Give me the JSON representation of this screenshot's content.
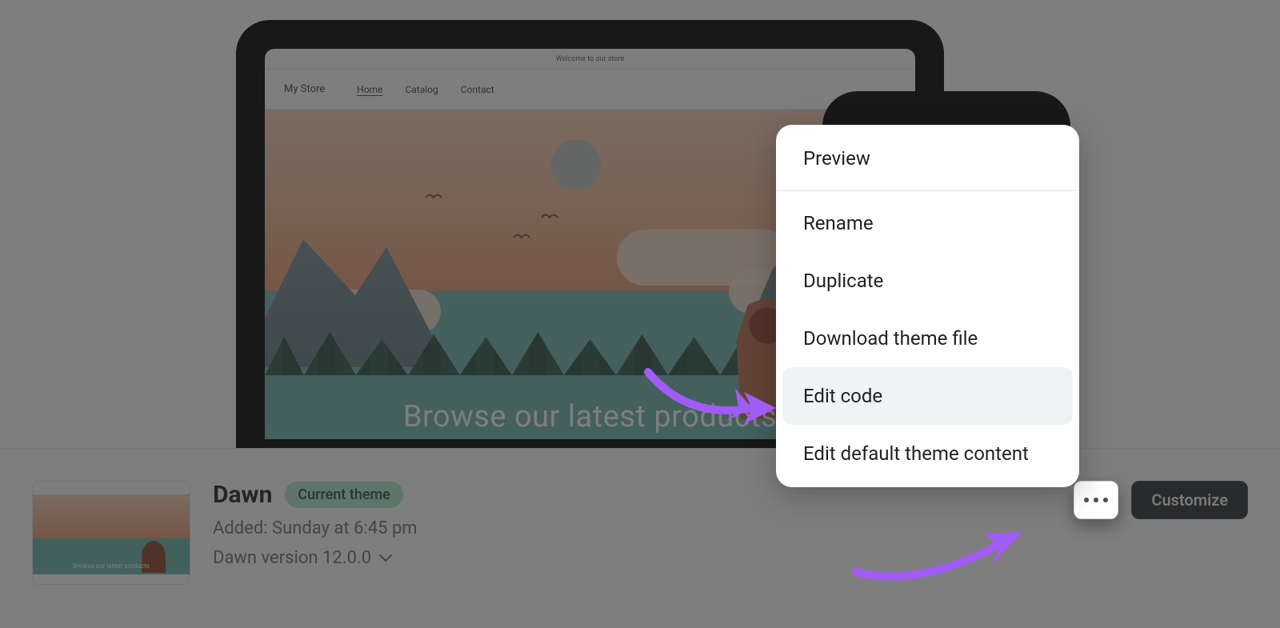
{
  "preview": {
    "announcement": "Welcome to our store",
    "store_name": "My Store",
    "nav": {
      "home": "Home",
      "catalog": "Catalog",
      "contact": "Contact"
    },
    "hero_text": "Browse our latest products"
  },
  "theme": {
    "name": "Dawn",
    "badge": "Current theme",
    "added_line": "Added: Sunday at 6:45 pm",
    "version_line": "Dawn version 12.0.0",
    "thumb_text": "Browse our latest products"
  },
  "actions": {
    "customize": "Customize"
  },
  "menu": {
    "preview": "Preview",
    "rename": "Rename",
    "duplicate": "Duplicate",
    "download": "Download theme file",
    "edit_code": "Edit code",
    "edit_default": "Edit default theme content"
  }
}
